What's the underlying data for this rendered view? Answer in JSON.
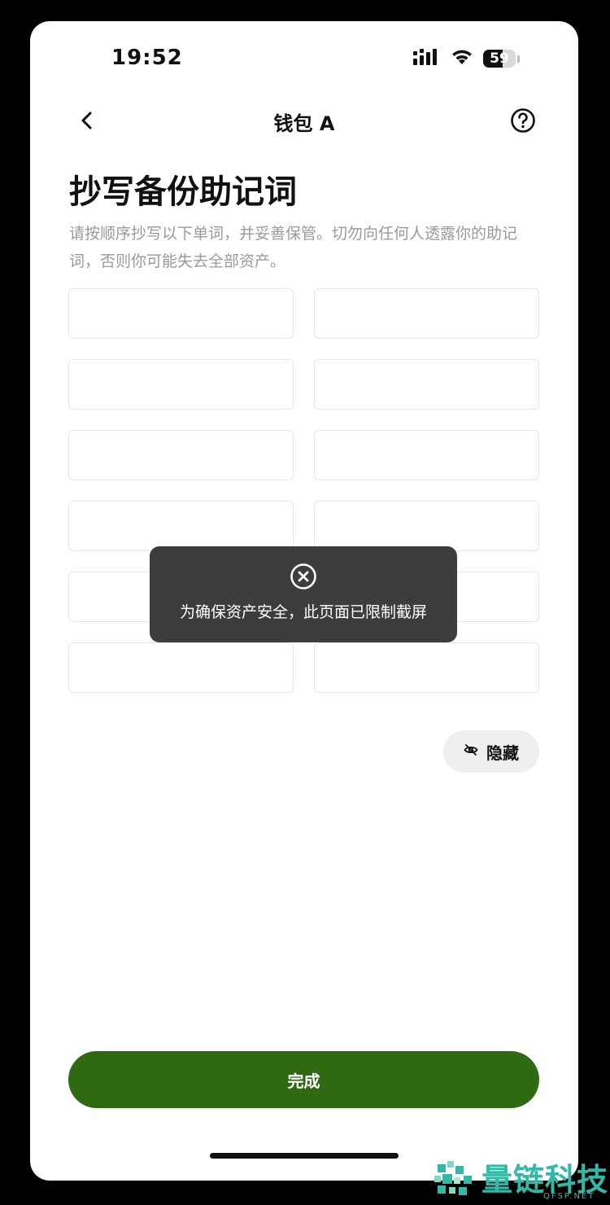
{
  "status_bar": {
    "time": "19:52",
    "battery_percent": 59,
    "battery_label": "59",
    "icons": [
      "cellular-signal-icon",
      "wifi-icon",
      "battery-icon"
    ]
  },
  "nav": {
    "back_icon": "chevron-left-icon",
    "title": "钱包 A",
    "help_icon": "question-circle-icon"
  },
  "page": {
    "title": "抄写备份助记词",
    "description": "请按顺序抄写以下单词，并妥善保管。切勿向任何人透露你的助记词，否则你可能失去全部资产。"
  },
  "mnemonic_grid": {
    "columns": 2,
    "rows": 6,
    "words": [
      "",
      "",
      "",
      "",
      "",
      "",
      "",
      "",
      "",
      "",
      "",
      ""
    ]
  },
  "hide_button": {
    "icon": "eye-off-icon",
    "label": "隐藏"
  },
  "toast": {
    "icon": "close-circle-icon",
    "message": "为确保资产安全，此页面已限制截屏"
  },
  "done_button": {
    "label": "完成"
  },
  "watermark": {
    "name": "量链科技",
    "url": "QFSP.NET"
  },
  "colors": {
    "primary": "#2f6a13",
    "toast_bg": "#3d3d3d",
    "description_text": "#9a9a9a",
    "cell_border": "#e6e6e6",
    "watermark": "#2fb9a6"
  }
}
